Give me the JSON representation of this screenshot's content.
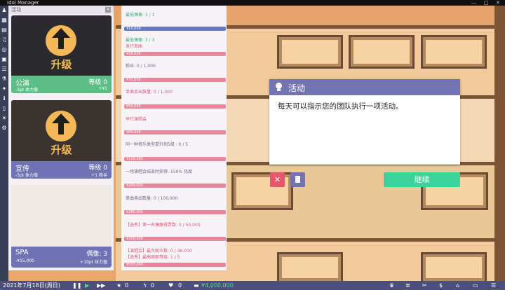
{
  "window": {
    "title": "Idol Manager"
  },
  "activity_panel": {
    "title": "活动",
    "cards": [
      {
        "name": "公演",
        "level_label": "等级 0",
        "cost": "-3pt 体力值",
        "reward": "+¥1",
        "upgrade": "升级"
      },
      {
        "name": "宣传",
        "level_label": "等级 0",
        "cost": "-3pt 体力值",
        "reward": "+1 粉丝",
        "upgrade": "升级"
      },
      {
        "name": "SPA",
        "level_label": "偶像: 3",
        "cost": "-¥15,000",
        "reward": "+10pt 体力值"
      }
    ]
  },
  "goals": [
    {
      "text": "最低偶像: 1 / 1",
      "price": "¥10,000"
    },
    {
      "text": "最低偶像: 3 / 3",
      "sub": "发行单曲",
      "price": "¥18,000"
    },
    {
      "text": "粉丝: 0 / 1,000",
      "price": "¥30,000"
    },
    {
      "text": "单曲卖出数量: 0 / 1,000",
      "price": "¥50,000"
    },
    {
      "text": "举行演唱会",
      "price": "¥80,000"
    },
    {
      "text": "同一种音乐类型提升到5级 : 0 / 5",
      "price": "¥120,000"
    },
    {
      "text": "一场演唱会结束时获得: 150% 热度",
      "price": "¥200,000"
    },
    {
      "text": "单曲卖出数量: 0 / 100,000",
      "price": "¥280,000"
    },
    {
      "text": "【选秀】第一名偶像得票数: 0 / 50,000",
      "price": "¥350,000"
    },
    {
      "text": "【演唱会】最大观众数: 0 / 48,000",
      "sub": "【选秀】最高国家等级: 1 / 5",
      "price": "¥500,000"
    }
  ],
  "dialog": {
    "title": "活动",
    "message": "每天可以指示您的团队执行一项活动。",
    "close": "✕",
    "continue": "继续"
  },
  "status_bar": {
    "date": "2021年7月18日(周日)",
    "stars": "0",
    "energy": "0",
    "fans": "0",
    "money": "¥4,000,000"
  }
}
